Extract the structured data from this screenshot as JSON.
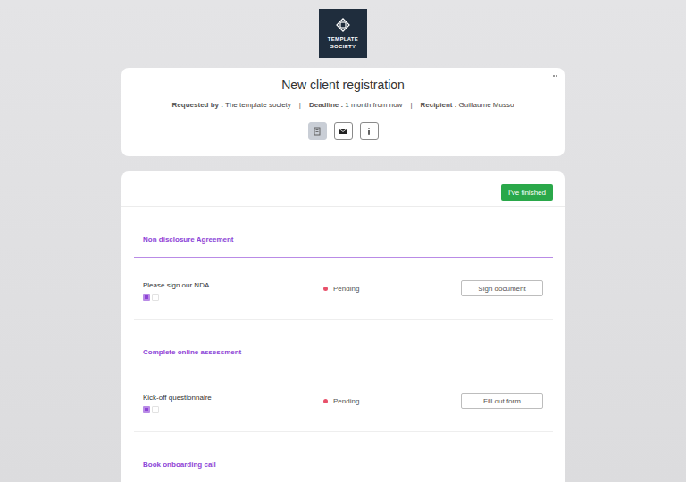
{
  "logo": {
    "lines": [
      "TEMPLATE",
      "SOCIETY"
    ]
  },
  "request": {
    "title": "New client registration",
    "separator": "|",
    "meta": [
      {
        "label": "Requested by :",
        "value": "The template society"
      },
      {
        "label": "Deadline :",
        "value": "1 month from now"
      },
      {
        "label": "Recipient :",
        "value": "Guillaume Musso"
      }
    ],
    "views": [
      {
        "kind": "document",
        "selected": true
      },
      {
        "kind": "email",
        "selected": false
      },
      {
        "kind": "info",
        "selected": false
      }
    ]
  },
  "finish_button": "I've finished",
  "sections": [
    {
      "title": "Non disclosure Agreement",
      "items": [
        {
          "name": "Please sign our NDA",
          "status": "Pending",
          "color": "#e8506a",
          "action": "Sign document"
        }
      ]
    },
    {
      "title": "Complete online assessment",
      "items": [
        {
          "name": "Kick-off questionnaire",
          "status": "Pending",
          "color": "#e8506a",
          "action": "Fill out form"
        }
      ]
    },
    {
      "title": "Book onboarding call",
      "items": []
    }
  ]
}
